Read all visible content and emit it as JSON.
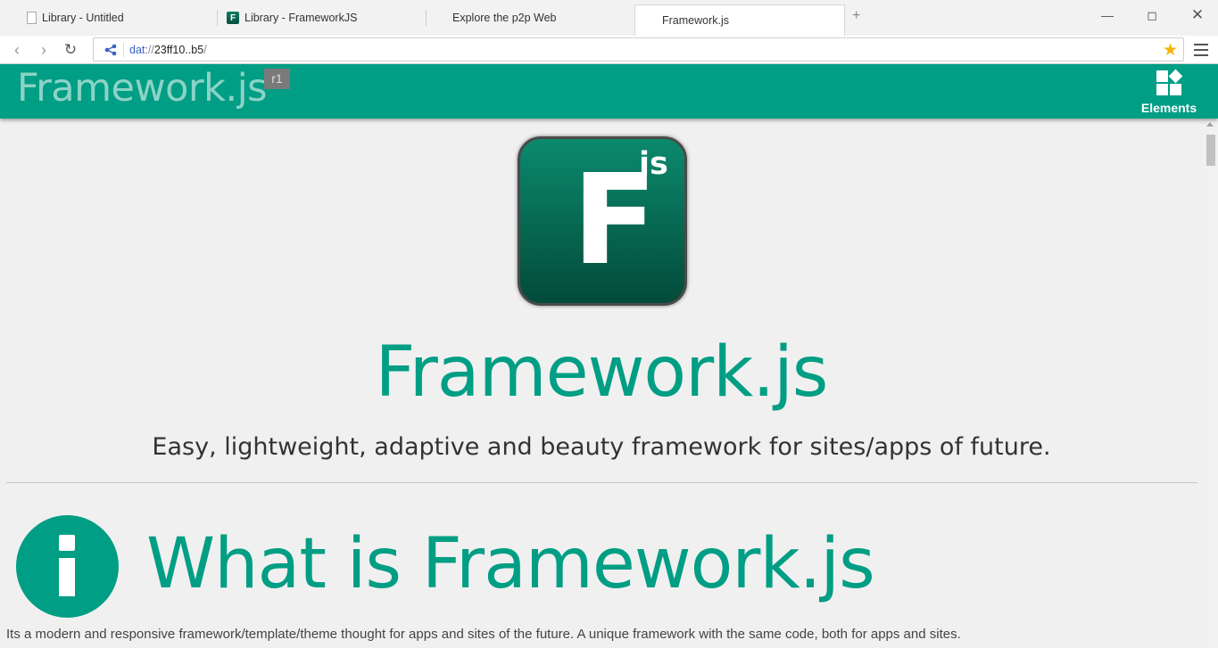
{
  "browser": {
    "tabs": [
      {
        "label": "Library - Untitled",
        "icon": "document-icon"
      },
      {
        "label": "Library - FrameworkJS",
        "icon": "framework-f-icon"
      },
      {
        "label": "Explore the p2p Web",
        "icon": ""
      },
      {
        "label": "Framework.js",
        "icon": "",
        "active": true
      }
    ],
    "new_tab": "+",
    "address": {
      "scheme": "dat:",
      "slashes": "//",
      "host": "23ff10..b5",
      "trail": "/"
    }
  },
  "appbar": {
    "title": "Framework.js",
    "version": "r1",
    "elements_label": "Elements"
  },
  "hero": {
    "logo_letter": "F",
    "logo_sup": "js",
    "title": "Framework.js",
    "tagline": "Easy, lightweight, adaptive and beauty framework for sites/apps of future."
  },
  "section": {
    "title": "What is Framework.js",
    "icon": "info-icon",
    "description": "Its a modern and responsive framework/template/theme thought for apps and sites of the future. A unique framework with the same code, both for apps and sites."
  },
  "colors": {
    "accent": "#009e84",
    "appbar": "#009e84"
  }
}
